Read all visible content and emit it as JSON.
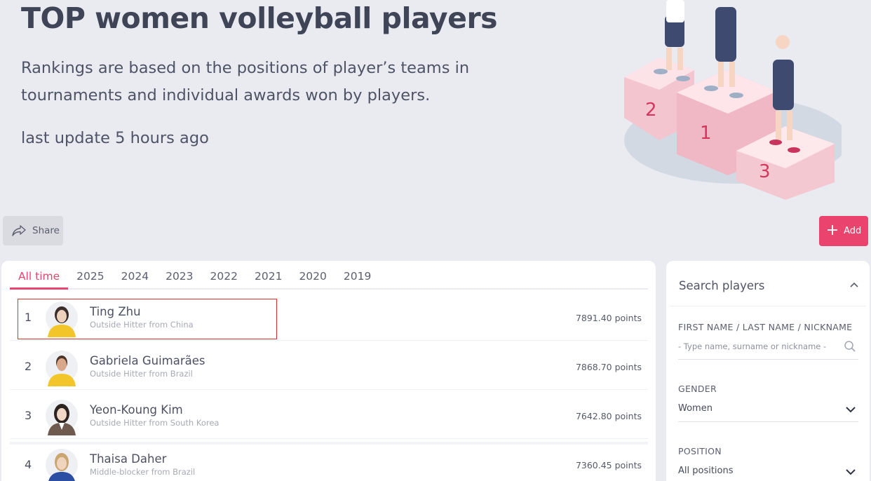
{
  "hero": {
    "title": "TOP women volleyball players",
    "description": "Rankings are based on the positions of player’s teams in tournaments and individual awards won by players.",
    "last_update": "last update 5 hours ago",
    "podium_numbers": [
      "2",
      "1",
      "3"
    ]
  },
  "actions": {
    "share_label": "Share",
    "add_label": "Add"
  },
  "tabs": [
    {
      "label": "All time",
      "active": true
    },
    {
      "label": "2025"
    },
    {
      "label": "2024"
    },
    {
      "label": "2023"
    },
    {
      "label": "2022"
    },
    {
      "label": "2021"
    },
    {
      "label": "2020"
    },
    {
      "label": "2019"
    }
  ],
  "players": [
    {
      "rank": "1",
      "name": "Ting Zhu",
      "desc": "Outside Hitter from China",
      "points": "7891.40 points"
    },
    {
      "rank": "2",
      "name": "Gabriela Guimarães",
      "desc": "Outside Hitter from Brazil",
      "points": "7868.70 points"
    },
    {
      "rank": "3",
      "name": "Yeon-Koung Kim",
      "desc": "Outside Hitter from South Korea",
      "points": "7642.80 points"
    },
    {
      "rank": "4",
      "name": "Thaisa Daher",
      "desc": "Middle-blocker from Brazil",
      "points": "7360.45 points"
    }
  ],
  "search": {
    "title": "Search players",
    "name_label": "FIRST NAME / LAST NAME / NICKNAME",
    "name_placeholder": "- Type name, surname or nickname -",
    "gender_label": "GENDER",
    "gender_value": "Women",
    "position_label": "POSITION",
    "position_value": "All positions"
  },
  "colors": {
    "accent": "#e6466f",
    "add_button": "#e9436e",
    "highlight_box": "#d9322f",
    "background": "#e9ebf1"
  },
  "icons": [
    "share-icon",
    "plus-icon",
    "chevron-up-icon",
    "search-icon",
    "chevron-down-icon"
  ]
}
